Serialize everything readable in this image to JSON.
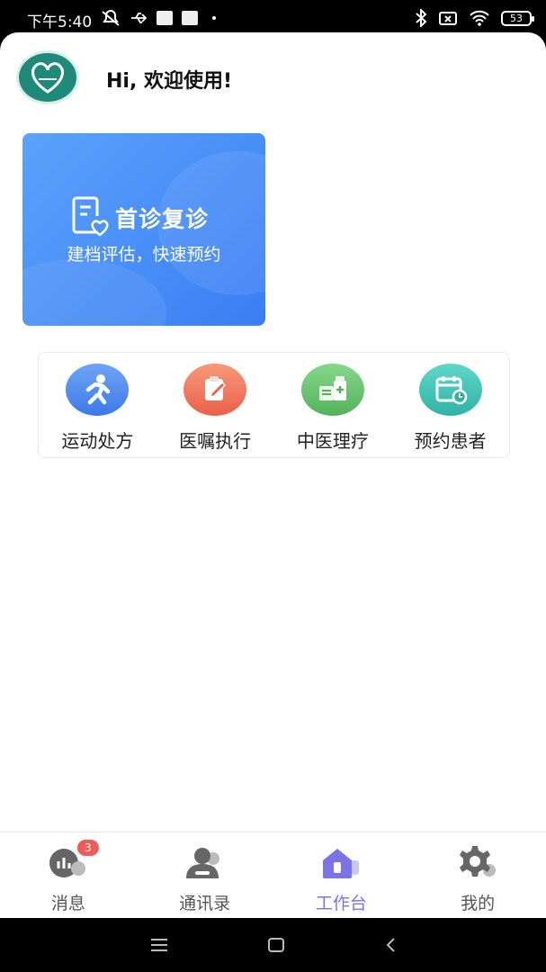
{
  "status_bar": {
    "time": "下午5:40",
    "battery": "53"
  },
  "header": {
    "greeting": "Hi, 欢迎使用!"
  },
  "hero_card": {
    "title": "首诊复诊",
    "subtitle": "建档评估，快速预约",
    "color_start": "#5aa2fb",
    "color_end": "#3a7ef4"
  },
  "quick_actions": [
    {
      "label": "运动处方",
      "icon": "running-person-icon",
      "color": "#4b86ef"
    },
    {
      "label": "医嘱执行",
      "icon": "clipboard-edit-icon",
      "color": "#ef7a5e"
    },
    {
      "label": "中医理疗",
      "icon": "medicine-icon",
      "color": "#6cc36c"
    },
    {
      "label": "预约患者",
      "icon": "calendar-clock-icon",
      "color": "#3dc3b4"
    }
  ],
  "tabbar": {
    "items": [
      {
        "label": "消息",
        "icon": "message-chart-icon",
        "badge": "3"
      },
      {
        "label": "通讯录",
        "icon": "contacts-icon"
      },
      {
        "label": "工作台",
        "icon": "workbench-home-icon",
        "active": true
      },
      {
        "label": "我的",
        "icon": "gear-icon"
      }
    ],
    "active_color": "#7b73e6"
  }
}
